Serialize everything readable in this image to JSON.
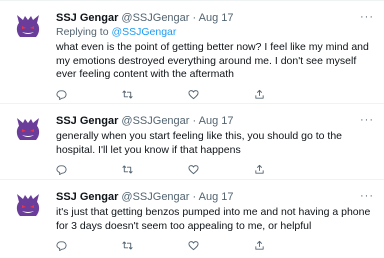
{
  "colors": {
    "accent": "#1d9bf0",
    "muted": "#536471",
    "text": "#0f1419",
    "avatar": "#6a3d9a"
  },
  "tweets": [
    {
      "name": "SSJ Gengar",
      "handle": "@SSJGengar",
      "dot": "·",
      "date": "Aug 17",
      "replying_prefix": "Replying to ",
      "replying_handle": "@SSJGengar",
      "text": "what even is the point of getting better now? I feel like my mind and my emotions destroyed everything around me. I don't see myself ever feeling content with the aftermath",
      "icons": [
        "reply-icon",
        "retweet-icon",
        "like-icon",
        "share-icon"
      ]
    },
    {
      "name": "SSJ Gengar",
      "handle": "@SSJGengar",
      "dot": "·",
      "date": "Aug 17",
      "text": "generally when you start feeling like this, you should go to the hospital. I'll let you know if that happens",
      "icons": [
        "reply-icon",
        "retweet-icon",
        "like-icon",
        "share-icon"
      ]
    },
    {
      "name": "SSJ Gengar",
      "handle": "@SSJGengar",
      "dot": "·",
      "date": "Aug 17",
      "text": "it's just that getting benzos pumped into me and not having a phone for 3 days doesn't seem too appealing to me, or helpful",
      "icons": [
        "reply-icon",
        "retweet-icon",
        "like-icon",
        "share-icon"
      ]
    }
  ]
}
